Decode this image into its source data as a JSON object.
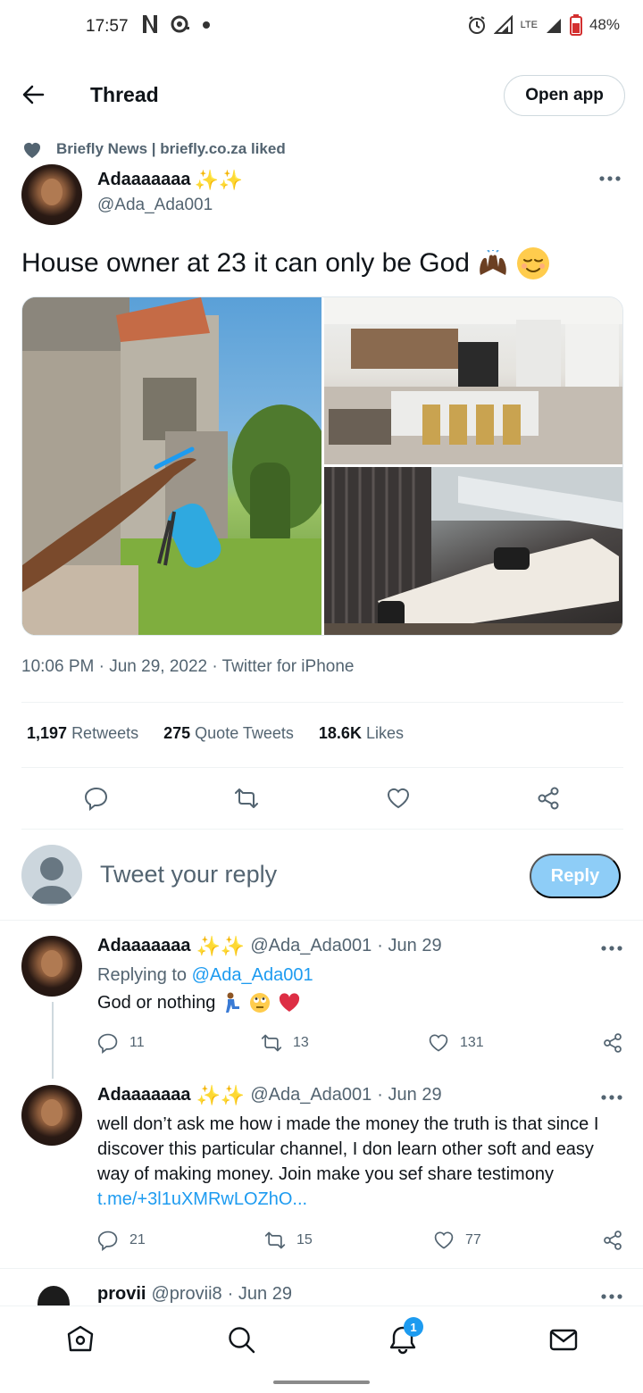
{
  "status_bar": {
    "time": "17:57",
    "battery": "48%",
    "network": "LTE"
  },
  "header": {
    "title": "Thread",
    "open_app_label": "Open app"
  },
  "liked_by": "Briefly News | briefly.co.za liked",
  "main_tweet": {
    "name": "Adaaaaaaa",
    "handle": "@Ada_Ada001",
    "text": "House owner at 23 it can only be God",
    "timestamp": "10:06 PM · Jun 29, 2022 · Twitter for iPhone",
    "stats": {
      "retweets_count": "1,197",
      "retweets_label": "Retweets",
      "quotes_count": "275",
      "quotes_label": "Quote Tweets",
      "likes_count": "18.6K",
      "likes_label": "Likes"
    }
  },
  "composer": {
    "placeholder": "Tweet your reply",
    "reply_label": "Reply"
  },
  "replies": [
    {
      "name": "Adaaaaaaa",
      "handle": "@Ada_Ada001",
      "date": "· Jun 29",
      "replying_label": "Replying to",
      "replying_to": "@Ada_Ada001",
      "text": "God or nothing",
      "reply_count": "11",
      "retweet_count": "13",
      "like_count": "131"
    },
    {
      "name": "Adaaaaaaa",
      "handle": "@Ada_Ada001",
      "date": "· Jun 29",
      "text_lines": [
        "well don’t ask me how i made the money the truth is that since I",
        "discover this particular channel, I don learn other soft and easy",
        "way of making money. Join make you sef share testimony"
      ],
      "link": "t.me/+3l1uXMRwLOZhO...",
      "reply_count": "21",
      "retweet_count": "15",
      "like_count": "77"
    },
    {
      "name": "provii",
      "handle": "@provii8",
      "date": "· Jun 29"
    }
  ],
  "bottom_nav": {
    "notification_badge": "1"
  },
  "colors": {
    "accent": "#1d9bf0",
    "reply_button": "#8ecdf7",
    "secondary_text": "#536471"
  }
}
